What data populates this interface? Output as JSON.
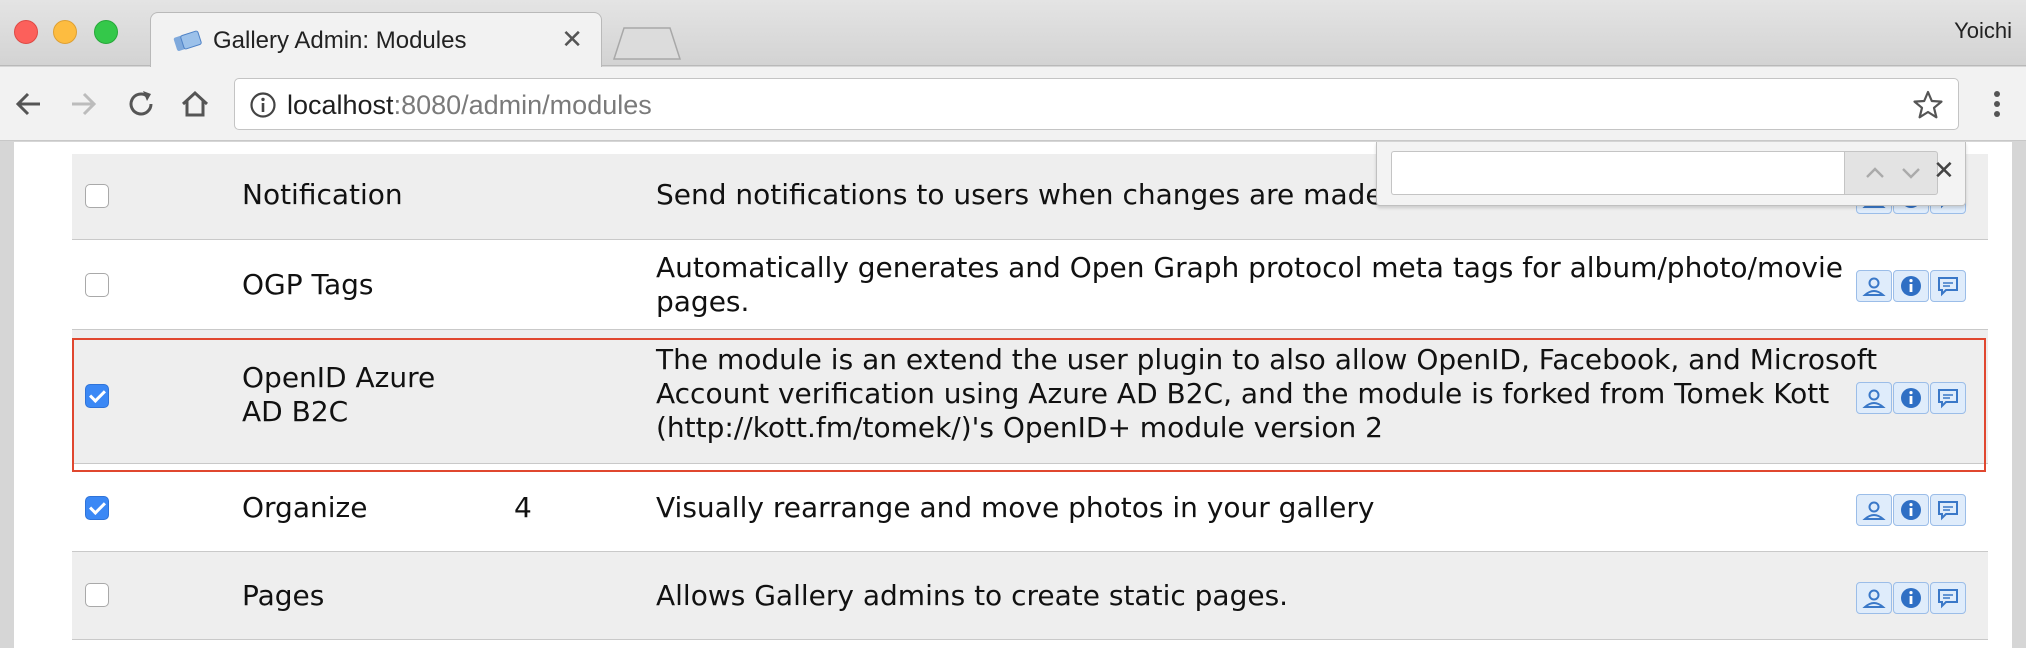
{
  "browser": {
    "tab_title": "Gallery Admin: Modules",
    "tab_close_glyph": "✕",
    "profile_name": "Yoichi",
    "url_host": "localhost",
    "url_rest": ":8080/admin/modules",
    "find_close_glyph": "✕"
  },
  "modules": [
    {
      "checked": false,
      "name": "Notification",
      "version": "",
      "description": "Send notifications to users when changes are made to watched albums."
    },
    {
      "checked": false,
      "name": "OGP Tags",
      "version": "",
      "description": "Automatically generates and Open Graph protocol meta tags for album/photo/movie pages."
    },
    {
      "checked": true,
      "name": "OpenID Azure AD B2C",
      "version": "",
      "description": "The module is an extend the user plugin to also allow OpenID, Facebook, and Microsoft Account verification using Azure AD B2C, and the module is forked from Tomek Kott (http://kott.fm/tomek/)'s OpenID+ module version 2",
      "highlighted": true
    },
    {
      "checked": true,
      "name": "Organize",
      "version": "4",
      "description": "Visually rearrange and move photos in your gallery"
    },
    {
      "checked": false,
      "name": "Pages",
      "version": "",
      "description": "Allows Gallery admins to create static pages."
    }
  ],
  "colors": {
    "highlight": "#e0472f",
    "checkbox_checked": "#3b88f5",
    "row_alt": "#eeeeee"
  },
  "icons": {
    "action_buttons": [
      "user-icon",
      "info-icon",
      "comment-icon"
    ]
  }
}
